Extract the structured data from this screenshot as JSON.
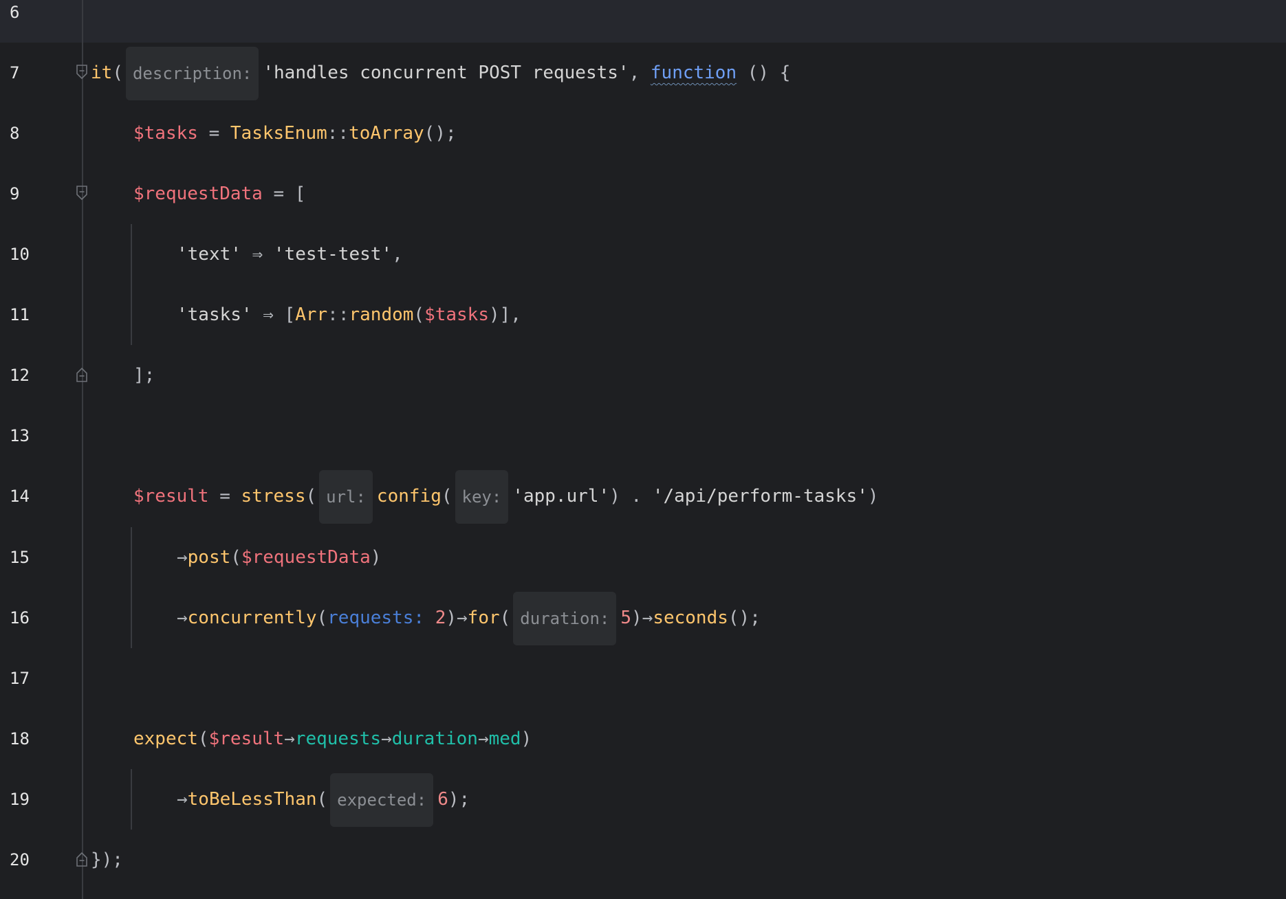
{
  "editor": {
    "colors": {
      "background": "#1e1f22",
      "variable": "#f0737c",
      "function": "#ffc66d",
      "keyword": "#6f9ff5",
      "property": "#20bfa9",
      "number": "#f08a8a",
      "hint_background": "#2b2d30"
    },
    "lines": [
      {
        "num": "6"
      },
      {
        "num": "7",
        "t": {
          "fn": "it",
          "p1": "(",
          "hint": "description:",
          "str": "'handles concurrent POST requests'",
          "p2": ", ",
          "kw": "function",
          "p3": " () {"
        }
      },
      {
        "num": "8",
        "t": {
          "var": "$tasks",
          "p1": " = ",
          "cls": "TasksEnum",
          "op": "::",
          "fn": "toArray",
          "p2": "();"
        }
      },
      {
        "num": "9",
        "t": {
          "var": "$requestData",
          "p1": " = ["
        }
      },
      {
        "num": "10",
        "t": {
          "str1": "'text'",
          "op": " ⇒ ",
          "str2": "'test-test'",
          "p1": ","
        }
      },
      {
        "num": "11",
        "t": {
          "str1": "'tasks'",
          "op": " ⇒ ",
          "p1": "[",
          "cls": "Arr",
          "op2": "::",
          "fn": "random",
          "p2": "(",
          "var": "$tasks",
          "p3": ")],"
        }
      },
      {
        "num": "12",
        "t": {
          "p1": "];"
        }
      },
      {
        "num": "13"
      },
      {
        "num": "14",
        "t": {
          "var": "$result",
          "p1": " = ",
          "fn": "stress",
          "p2": "(",
          "hint1": "url:",
          "fn2": "config",
          "p3": "(",
          "hint2": "key:",
          "str1": "'app.url'",
          "p4": ") . ",
          "str2": "'/api/perform-tasks'",
          "p5": ")"
        }
      },
      {
        "num": "15",
        "t": {
          "op": "→",
          "fn": "post",
          "p1": "(",
          "var": "$requestData",
          "p2": ")"
        }
      },
      {
        "num": "16",
        "t": {
          "op": "→",
          "fn": "concurrently",
          "p1": "(",
          "named": "requests: ",
          "num": "2",
          "p2": ")",
          "op2": "→",
          "fn2": "for",
          "p3": "(",
          "hint": "duration:",
          "num2": "5",
          "p4": ")",
          "op3": "→",
          "fn3": "seconds",
          "p5": "();"
        }
      },
      {
        "num": "17"
      },
      {
        "num": "18",
        "t": {
          "fn": "expect",
          "p1": "(",
          "var": "$result",
          "op": "→",
          "prop1": "requests",
          "op2": "→",
          "prop2": "duration",
          "op3": "→",
          "prop3": "med",
          "p2": ")"
        }
      },
      {
        "num": "19",
        "t": {
          "op": "→",
          "fn": "toBeLessThan",
          "p1": "(",
          "hint": "expected:",
          "num": "6",
          "p2": ");"
        }
      },
      {
        "num": "20",
        "t": {
          "p1": "});"
        }
      }
    ]
  }
}
